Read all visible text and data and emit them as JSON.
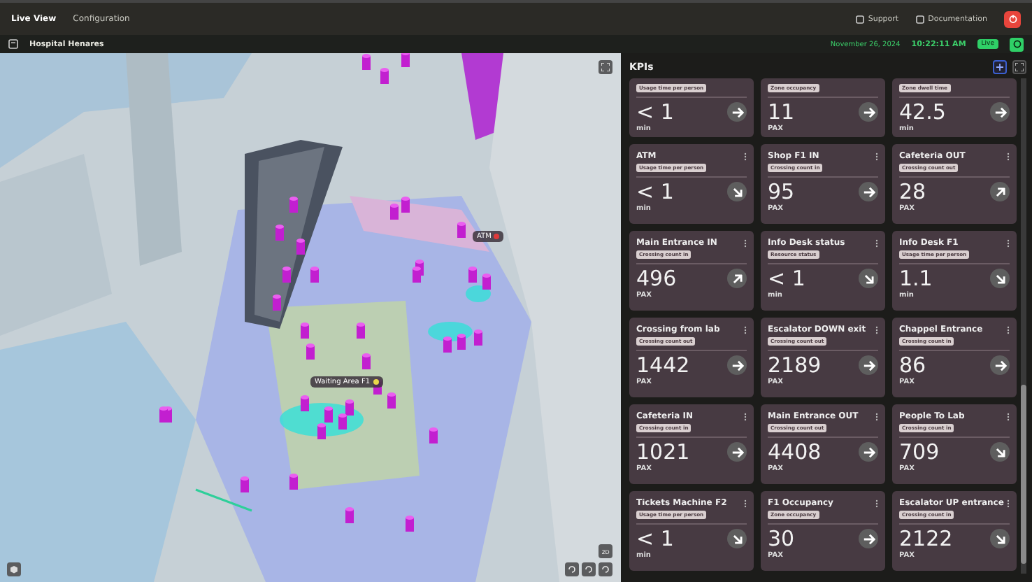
{
  "topbar": {
    "tabs": [
      {
        "label": "Live View",
        "selected": true
      },
      {
        "label": "Configuration",
        "selected": false
      }
    ],
    "links": [
      "Support",
      "Documentation"
    ]
  },
  "subbar": {
    "site": "Hospital Henares",
    "date": "November 26, 2024",
    "time": "10:22:11 AM",
    "live_badge": "Live"
  },
  "map": {
    "labels": [
      {
        "text": "Waiting Area F1",
        "color": "#e8d84a"
      },
      {
        "text": "ATM",
        "color": "#e03a3a"
      }
    ],
    "view_toggle": "2D"
  },
  "kpis": {
    "title": "KPIs",
    "cards": [
      {
        "badge": "Usage time per person",
        "value": "< 1",
        "unit": "min",
        "kind": "flat"
      },
      {
        "badge": "Zone occupancy",
        "value": "11",
        "unit": "PAX",
        "kind": "flat"
      },
      {
        "badge": "Zone dwell time",
        "value": "42.5",
        "unit": "min",
        "kind": "flat"
      },
      {
        "title": "ATM",
        "badge": "Usage time per person",
        "value": "< 1",
        "unit": "min",
        "kind": "falling"
      },
      {
        "title": "Shop F1 IN",
        "badge": "Crossing count in",
        "value": "95",
        "unit": "PAX",
        "kind": "flat"
      },
      {
        "title": "Cafeteria OUT",
        "badge": "Crossing count out",
        "value": "28",
        "unit": "PAX",
        "kind": "rising"
      },
      {
        "title": "Main Entrance IN",
        "badge": "Crossing count in",
        "value": "496",
        "unit": "PAX",
        "kind": "rising"
      },
      {
        "title": "Info Desk status",
        "badge": "Resource status",
        "value": "< 1",
        "unit": "min",
        "kind": "falling"
      },
      {
        "title": "Info Desk F1",
        "badge": "Usage time per person",
        "value": "1.1",
        "unit": "min",
        "kind": "falling"
      },
      {
        "title": "Crossing from lab",
        "badge": "Crossing count out",
        "value": "1442",
        "unit": "PAX",
        "kind": "flat"
      },
      {
        "title": "Escalator DOWN exit",
        "badge": "Crossing count out",
        "value": "2189",
        "unit": "PAX",
        "kind": "flat"
      },
      {
        "title": "Chappel Entrance",
        "badge": "Crossing count in",
        "value": "86",
        "unit": "PAX",
        "kind": "flat"
      },
      {
        "title": "Cafeteria IN",
        "badge": "Crossing count in",
        "value": "1021",
        "unit": "PAX",
        "kind": "flat"
      },
      {
        "title": "Main Entrance OUT",
        "badge": "Crossing count out",
        "value": "4408",
        "unit": "PAX",
        "kind": "flat"
      },
      {
        "title": "People To Lab",
        "badge": "Crossing count in",
        "value": "709",
        "unit": "PAX",
        "kind": "falling"
      },
      {
        "title": "Tickets Machine F2",
        "badge": "Usage time per person",
        "value": "< 1",
        "unit": "min",
        "kind": "falling"
      },
      {
        "title": "F1 Occupancy",
        "badge": "Zone occupancy",
        "value": "30",
        "unit": "PAX",
        "kind": "flat"
      },
      {
        "title": "Escalator UP entrance",
        "badge": "Crossing count in",
        "value": "2122",
        "unit": "PAX",
        "kind": "falling"
      }
    ]
  }
}
